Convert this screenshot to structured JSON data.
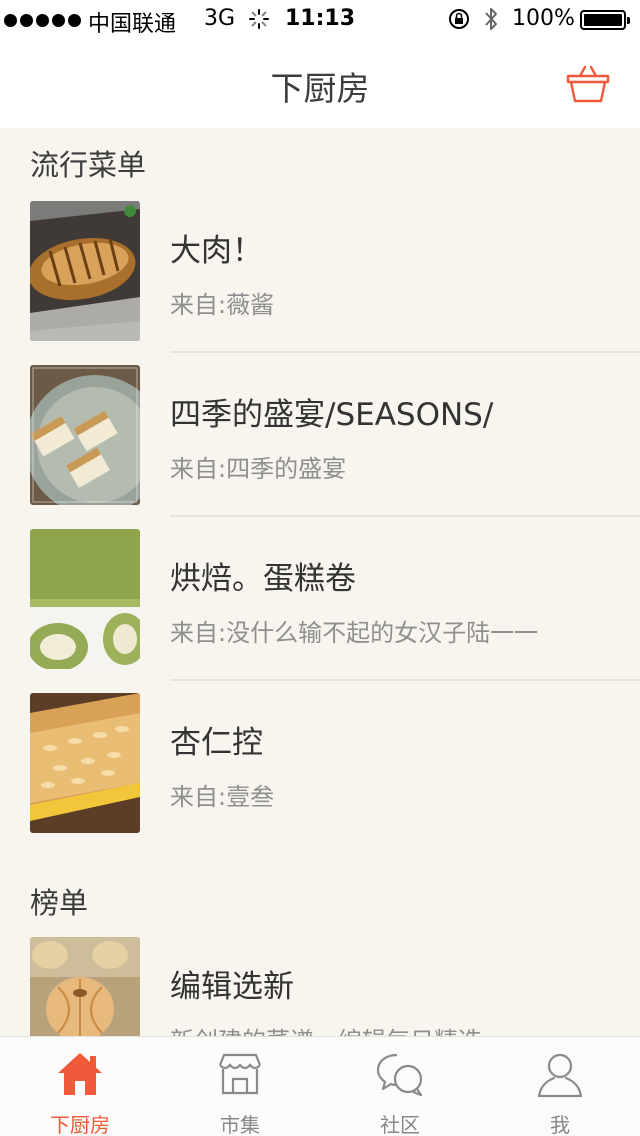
{
  "status_bar": {
    "carrier": "中国联通",
    "network": "3G",
    "time": "11:13",
    "battery": "100%"
  },
  "nav": {
    "title": "下厨房",
    "cart_icon": "basket-icon"
  },
  "sections": {
    "popular_menus": {
      "title": "流行菜单",
      "items": [
        {
          "title": "大肉！",
          "subtitle": "来自:薇酱"
        },
        {
          "title": "四季的盛宴/SEASONS/",
          "subtitle": "来自:四季的盛宴"
        },
        {
          "title": "烘焙。蛋糕卷",
          "subtitle": "来自:没什么输不起的女汉子陆一一"
        },
        {
          "title": "杏仁控",
          "subtitle": "来自:壹叁"
        }
      ]
    },
    "rankings": {
      "title": "榜单",
      "items": [
        {
          "title": "编辑选新",
          "subtitle": "新创建的菜谱，编辑每日精选"
        }
      ]
    }
  },
  "tabbar": {
    "accent_color": "#f05a3a",
    "tabs": [
      {
        "label": "下厨房",
        "icon": "home-icon",
        "active": true
      },
      {
        "label": "市集",
        "icon": "store-icon",
        "active": false
      },
      {
        "label": "社区",
        "icon": "chat-bubbles-icon",
        "active": false
      },
      {
        "label": "我",
        "icon": "profile-icon",
        "active": false
      }
    ]
  }
}
